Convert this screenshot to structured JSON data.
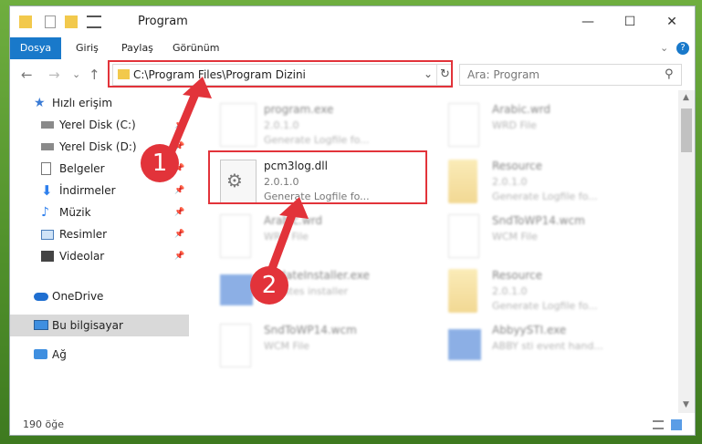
{
  "window": {
    "title": "Program",
    "min_glyph": "—",
    "max_glyph": "☐",
    "close_glyph": "✕"
  },
  "ribbon": {
    "tabs": [
      "Dosya",
      "Giriş",
      "Paylaş",
      "Görünüm"
    ],
    "help_glyph": "?"
  },
  "nav": {
    "back": "←",
    "forward": "→",
    "down": "⌄",
    "up": "↑"
  },
  "address": {
    "path": "C:\\Program Files\\Program Dizini"
  },
  "search": {
    "placeholder": "Ara: Program"
  },
  "sidebar": {
    "items": [
      {
        "label": "Hızlı erişim",
        "icon": "star-icon"
      },
      {
        "label": "Yerel Disk (C:)",
        "icon": "drive-icon"
      },
      {
        "label": "Yerel Disk (D:)",
        "icon": "drive-icon"
      },
      {
        "label": "Belgeler",
        "icon": "documents-icon"
      },
      {
        "label": "İndirmeler",
        "icon": "download-icon"
      },
      {
        "label": "Müzik",
        "icon": "music-icon"
      },
      {
        "label": "Resimler",
        "icon": "pictures-icon"
      },
      {
        "label": "Videolar",
        "icon": "videos-icon"
      },
      {
        "label": "OneDrive",
        "icon": "cloud-icon"
      },
      {
        "label": "Bu bilgisayar",
        "icon": "computer-icon"
      },
      {
        "label": "Ağ",
        "icon": "network-icon"
      }
    ]
  },
  "files": [
    {
      "name": "program.exe",
      "sub1": "2.0.1.0",
      "sub2": "Generate Logfile fo..."
    },
    {
      "name": "Arabic.wrd",
      "sub1": "WRD File",
      "sub2": ""
    },
    {
      "name": "pcm3log.dll",
      "sub1": "2.0.1.0",
      "sub2": "Generate Logfile fo..."
    },
    {
      "name": "Resource",
      "sub1": "2.0.1.0",
      "sub2": "Generate Logfile fo..."
    },
    {
      "name": "Arabic.wrd",
      "sub1": "WRD File",
      "sub2": ""
    },
    {
      "name": "SndToWP14.wcm",
      "sub1": "WCM File",
      "sub2": ""
    },
    {
      "name": "UpdateInstaller.exe",
      "sub1": "updates installer",
      "sub2": ""
    },
    {
      "name": "Resource",
      "sub1": "2.0.1.0",
      "sub2": "Generate Logfile fo..."
    },
    {
      "name": "SndToWP14.wcm",
      "sub1": "WCM File",
      "sub2": ""
    },
    {
      "name": "AbbyySTI.exe",
      "sub1": "ABBY sti event hand...",
      "sub2": ""
    }
  ],
  "status": {
    "count": "190 öğe"
  },
  "badges": [
    "1",
    "2"
  ],
  "colors": {
    "accent": "#1979ca",
    "highlight": "#e2333a"
  }
}
